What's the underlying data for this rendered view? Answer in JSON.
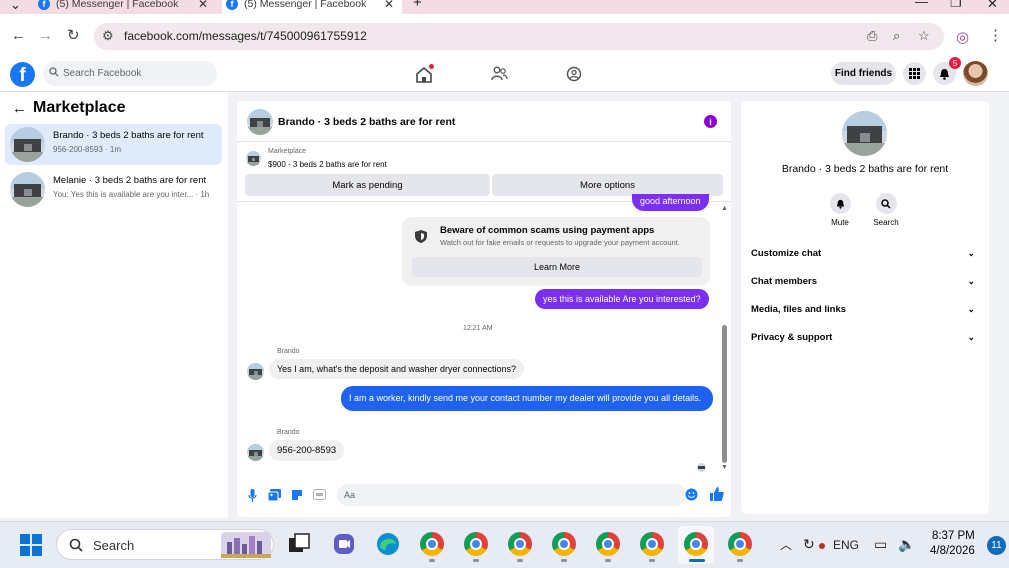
{
  "browser": {
    "tabs": [
      {
        "title": "(5) Messenger | Facebook",
        "active": false
      },
      {
        "title": "(5) Messenger | Facebook",
        "active": true
      }
    ],
    "new_tab_icon": "plus-icon",
    "url": "facebook.com/messages/t/745000961755912"
  },
  "facebook": {
    "logo": "f",
    "search_placeholder": "Search Facebook",
    "find_friends_label": "Find friends",
    "notification_count": "5",
    "accent_color": "#1877f2"
  },
  "sidebar": {
    "title": "Marketplace",
    "conversations": [
      {
        "name": "Brando · 3 beds 2 baths are for rent",
        "preview": "956-200-8593 · 1m",
        "selected": true
      },
      {
        "name": "Melanie · 3 beds 2 baths are for rent",
        "preview": "You: Yes this is available are you inter... · 1h",
        "selected": false
      }
    ]
  },
  "chat": {
    "title": "Brando · 3 beds 2 baths are for rent",
    "marketplace_label": "Marketplace",
    "listing_price": "$900 - 3 beds 2 baths are for rent",
    "mark_pending_label": "Mark as pending",
    "more_options_label": "More options",
    "partial_message": "good afternoon",
    "scam_notice": {
      "title": "Beware of common scams using payment apps",
      "body": "Watch out for fake emails or requests to upgrade your payment account.",
      "button": "Learn More"
    },
    "messages": [
      {
        "from": "me",
        "text": "yes this is available Are you interested?"
      },
      {
        "type": "timestamp",
        "text": "12:21 AM"
      },
      {
        "from": "Brando",
        "text": "Yes I am, what's the deposit and washer dryer connections?"
      },
      {
        "from": "me",
        "text": "I am a worker, kindly send me your contact number my dealer will provide you all details."
      },
      {
        "from": "Brando",
        "text": "956-200-8593"
      }
    ],
    "composer_placeholder": "Aa"
  },
  "details": {
    "title": "Brando · 3 beds 2 baths are for rent",
    "actions": [
      {
        "label": "Mute",
        "icon": "bell-icon"
      },
      {
        "label": "Search",
        "icon": "search-icon"
      }
    ],
    "sections": [
      "Customize chat",
      "Chat members",
      "Media, files and links",
      "Privacy & support"
    ]
  },
  "taskbar": {
    "search_label": "Search",
    "language": "ENG",
    "time": "8:37 PM",
    "date": "4/8/2026",
    "notification_count": "11"
  }
}
